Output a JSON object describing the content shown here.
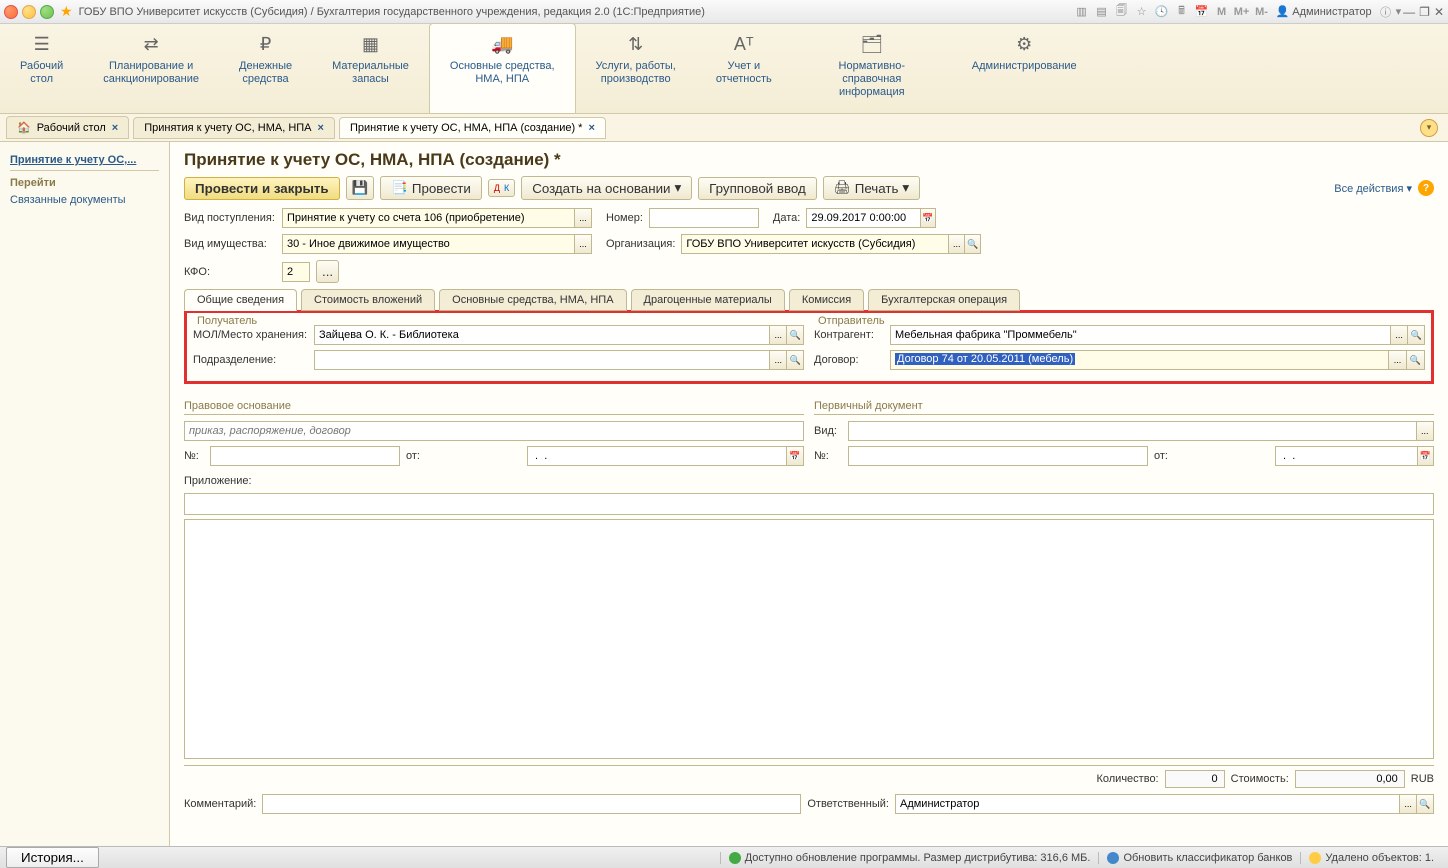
{
  "titlebar": {
    "title": "ГОБУ ВПО Университет искусств (Субсидия) / Бухгалтерия государственного учреждения, редакция 2.0  (1С:Предприятие)",
    "user": "Администратор",
    "m_labels": [
      "M",
      "M+",
      "M-"
    ]
  },
  "ribbon": [
    {
      "label": "Рабочий\nстол",
      "icon": "☰"
    },
    {
      "label": "Планирование и\nсанкционирование",
      "icon": "⇄"
    },
    {
      "label": "Денежные\nсредства",
      "icon": "₽"
    },
    {
      "label": "Материальные\nзапасы",
      "icon": "▦"
    },
    {
      "label": "Основные средства,\nНМА, НПА",
      "icon": "🚚",
      "active": true
    },
    {
      "label": "Услуги, работы,\nпроизводство",
      "icon": "⇅"
    },
    {
      "label": "Учет и\nотчетность",
      "icon": "Аᵀ"
    },
    {
      "label": "Нормативно-справочная\nинформация",
      "icon": "🗂"
    },
    {
      "label": "Администрирование",
      "icon": "⚙"
    }
  ],
  "tabs": [
    {
      "label": "Рабочий стол",
      "closable": true,
      "icon": "home"
    },
    {
      "label": "Принятия к учету ОС, НМА, НПА",
      "closable": true
    },
    {
      "label": "Принятие к учету ОС, НМА, НПА (создание) *",
      "closable": true,
      "active": true
    }
  ],
  "sidebar": {
    "title": "Принятие к учету ОС,...",
    "section": "Перейти",
    "links": [
      "Связанные документы"
    ]
  },
  "page": {
    "title": "Принятие к учету ОС, НМА, НПА (создание) *"
  },
  "toolbar": {
    "post_close": "Провести и закрыть",
    "post": "Провести",
    "create_based": "Создать на основании",
    "group_input": "Групповой ввод",
    "print": "Печать",
    "all_actions": "Все действия"
  },
  "header_fields": {
    "receipt_type_lbl": "Вид поступления:",
    "receipt_type_val": "Принятие к учету со счета 106 (приобретение)",
    "number_lbl": "Номер:",
    "number_val": "",
    "date_lbl": "Дата:",
    "date_val": "29.09.2017 0:00:00",
    "property_type_lbl": "Вид имущества:",
    "property_type_val": "30 - Иное движимое имущество",
    "org_lbl": "Организация:",
    "org_val": "ГОБУ ВПО Университет искусств (Субсидия)",
    "kfo_lbl": "КФО:",
    "kfo_val": "2"
  },
  "doc_tabs": [
    "Общие сведения",
    "Стоимость вложений",
    "Основные средства, НМА, НПА",
    "Драгоценные материалы",
    "Комиссия",
    "Бухгалтерская операция"
  ],
  "recipient": {
    "legend": "Получатель",
    "mol_lbl": "МОЛ/Место хранения:",
    "mol_val": "Зайцева О. К. - Библиотека",
    "dept_lbl": "Подразделение:",
    "dept_val": ""
  },
  "sender": {
    "legend": "Отправитель",
    "cp_lbl": "Контрагент:",
    "cp_val": "Мебельная фабрика \"Проммебель\"",
    "contract_lbl": "Договор:",
    "contract_val": "Договор 74 от 20.05.2011 (мебель)"
  },
  "legal": {
    "legend": "Правовое основание",
    "placeholder": "приказ, распоряжение, договор",
    "num_lbl": "№:",
    "from_lbl": "от:",
    "date_val": " .  .    "
  },
  "primary": {
    "legend": "Первичный документ",
    "type_lbl": "Вид:",
    "num_lbl": "№:",
    "from_lbl": "от:",
    "date_val": " .  .    "
  },
  "attachment_lbl": "Приложение:",
  "totals": {
    "qty_lbl": "Количество:",
    "qty_val": "0",
    "cost_lbl": "Стоимость:",
    "cost_val": "0,00",
    "currency": "RUB"
  },
  "footer": {
    "comment_lbl": "Комментарий:",
    "resp_lbl": "Ответственный:",
    "resp_val": "Администратор"
  },
  "statusbar": {
    "history": "История...",
    "update_msg": "Доступно обновление программы. Размер дистрибутива: 316,6 МБ.",
    "classifier": "Обновить классификатор банков",
    "deleted": "Удалено объектов: 1."
  }
}
